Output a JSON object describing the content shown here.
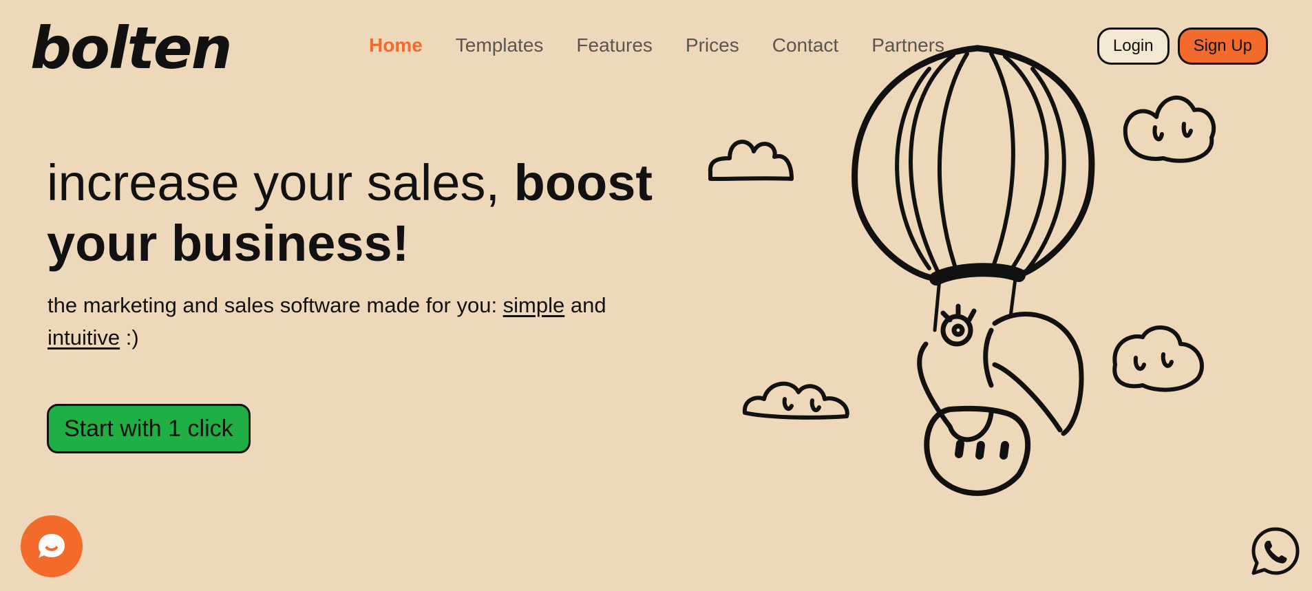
{
  "brand": {
    "name": "bolten"
  },
  "nav": {
    "items": [
      {
        "label": "Home",
        "active": true
      },
      {
        "label": "Templates",
        "active": false
      },
      {
        "label": "Features",
        "active": false
      },
      {
        "label": "Prices",
        "active": false
      },
      {
        "label": "Contact",
        "active": false
      },
      {
        "label": "Partners",
        "active": false
      }
    ]
  },
  "auth": {
    "login_label": "Login",
    "signup_label": "Sign Up"
  },
  "hero": {
    "title_regular": "increase your sales, ",
    "title_bold": "boost your business!",
    "subtitle_prefix": "the marketing and sales software made for you: ",
    "subtitle_link1": "simple",
    "subtitle_middle": " and ",
    "subtitle_link2": "intuitive",
    "subtitle_suffix": " :)",
    "cta_label": "Start with 1 click"
  },
  "illustration": {
    "subject": "hot-air-balloon-with-toucan-and-clouds"
  },
  "widgets": {
    "chat_icon": "chat-bubble-icon",
    "whatsapp_icon": "whatsapp-icon"
  },
  "colors": {
    "background": "#EDD8BA",
    "accent": "#F26B2A",
    "cta": "#20AF45",
    "text": "#111111",
    "nav_text": "#5B554E"
  }
}
